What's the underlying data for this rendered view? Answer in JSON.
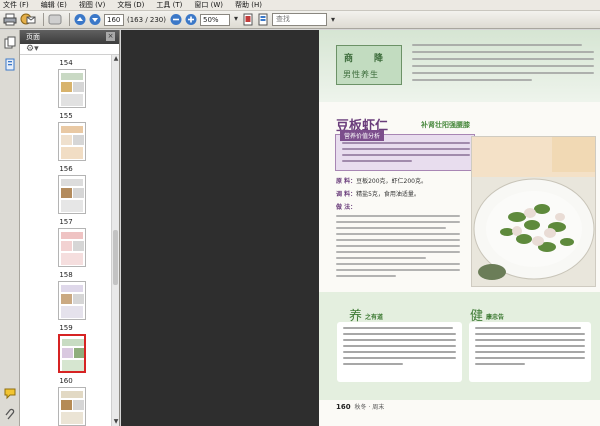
{
  "menu": [
    "文件 (F)",
    "编辑 (E)",
    "视图 (V)",
    "文档 (D)",
    "工具 (T)",
    "窗口 (W)",
    "帮助 (H)"
  ],
  "toolbar": {
    "page_current": "160",
    "page_total": "(163 / 230)",
    "zoom": "50%",
    "search_placeholder": "查找"
  },
  "thumbnails": {
    "header": "页面",
    "close": "×",
    "pages": [
      "154",
      "155",
      "156",
      "157",
      "158",
      "159",
      "160"
    ],
    "selected": "159"
  },
  "document": {
    "logo_char_1": "商",
    "logo_char_2": "降",
    "logo_subtitle": "男性养生",
    "title": "豆板虾仁",
    "subtitle": "补肾壮阳强腰膝",
    "infobox_label": "营养价值分析",
    "ingredients": [
      {
        "label": "原 料：",
        "text": "豆板200克，虾仁200克。"
      },
      {
        "label": "调 料：",
        "text": "精盐5克，食用油适量。"
      },
      {
        "label": "做 法：",
        "text": ""
      }
    ],
    "section_a_char": "养",
    "section_a_title": "之有道",
    "section_b_char": "健",
    "section_b_title": "康忠告",
    "footer_page": "160",
    "footer_text": "秋冬 · 周末"
  },
  "colors": {
    "accent_purple": "#6a3d7b",
    "accent_green": "#3d7a33",
    "canvas": "#2e2e2e",
    "selected_thumb_border": "#d62323"
  }
}
